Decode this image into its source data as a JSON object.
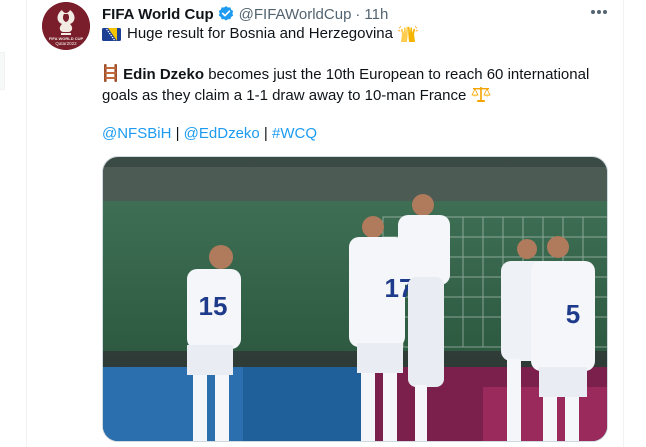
{
  "tweet": {
    "author": {
      "display_name": "FIFA World Cup",
      "handle": "@FIFAWorldCup",
      "verified": true,
      "avatar_icon": "fifa-world-cup-qatar-2022-logo",
      "avatar_text": "FIFA WORLD CUP Qatar2022"
    },
    "separator": "·",
    "time": "11h",
    "more_icon": "more-horizontal-icon",
    "text": {
      "line1": "Huge result for Bosnia and Herzegovina",
      "line1_icons": [
        "bosnia-flag-icon",
        "raising-hands-emoji"
      ],
      "para2_icon": "ladder-emoji",
      "para2_bold": "Edin Dzeko",
      "para2_rest": "becomes just the 10th European to reach 60 international goals as they claim a 1-1 draw away to 10-man France",
      "para2_end_icon": "balance-scale-emoji",
      "tags": [
        {
          "label": "@NFSBiH"
        },
        {
          "label": "@EdDzeko"
        },
        {
          "label": "#WCQ"
        }
      ],
      "tag_separator": "|"
    },
    "media": {
      "kind": "photo",
      "icon": "photo-bosnia-players-celebrating",
      "jersey_numbers": [
        "15",
        "17",
        "5"
      ]
    }
  },
  "colors": {
    "link": "#1d9bf0",
    "secondary_text": "#536471",
    "verified_badge": "#1d9bf0",
    "avatar_bg": "#7a1e2c"
  }
}
